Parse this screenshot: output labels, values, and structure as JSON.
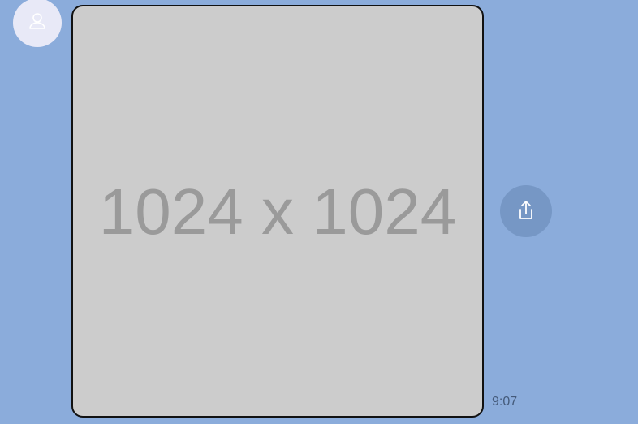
{
  "avatar": {
    "icon": "user-icon"
  },
  "message": {
    "image_placeholder_text": "1024 x 1024",
    "timestamp": "9:07"
  },
  "actions": {
    "share_icon": "share-icon"
  },
  "colors": {
    "background": "#8bacdb",
    "avatar_bg": "#e8e9f7",
    "image_bg": "#cccccc",
    "share_button_bg": "#7697c5"
  }
}
